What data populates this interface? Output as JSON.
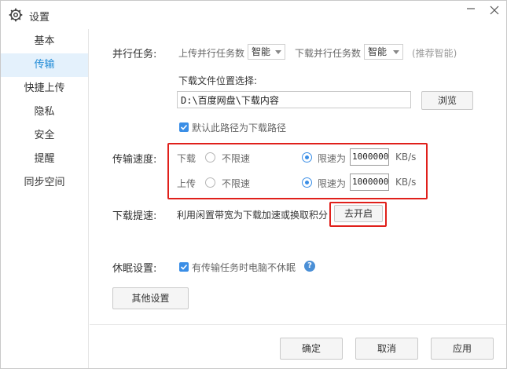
{
  "window": {
    "title": "设置"
  },
  "sidebar": {
    "items": [
      {
        "label": "基本"
      },
      {
        "label": "传输",
        "active": true
      },
      {
        "label": "快捷上传"
      },
      {
        "label": "隐私"
      },
      {
        "label": "安全"
      },
      {
        "label": "提醒"
      },
      {
        "label": "同步空间"
      }
    ]
  },
  "parallel": {
    "label": "并行任务:",
    "upload_label": "上传并行任务数",
    "upload_value": "智能",
    "download_label": "下载并行任务数",
    "download_value": "智能",
    "hint": "(推荐智能)"
  },
  "download_location": {
    "label": "下载文件位置选择:",
    "path": "D:\\百度网盘\\下载内容",
    "browse_label": "浏览",
    "default_checkbox_label": "默认此路径为下载路径",
    "default_checked": true
  },
  "speed": {
    "label": "传输速度:",
    "unlimited_label": "不限速",
    "limit_label": "限速为",
    "unit": "KB/s",
    "download": {
      "label": "下载",
      "value": "1000000",
      "mode": "limit"
    },
    "upload": {
      "label": "上传",
      "value": "1000000",
      "mode": "limit"
    }
  },
  "boost": {
    "label": "下载提速:",
    "description": "利用闲置带宽为下载加速或换取积分",
    "button_label": "去开启"
  },
  "sleep": {
    "label": "休眠设置:",
    "checkbox_label": "有传输任务时电脑不休眠",
    "checked": true,
    "help_glyph": "?"
  },
  "other_settings_label": "其他设置",
  "footer": {
    "ok_label": "确定",
    "cancel_label": "取消",
    "apply_label": "应用"
  },
  "colors": {
    "accent": "#3a8ee6",
    "active_bg": "#e4f1fc",
    "active_text": "#1e8ad6",
    "highlight": "#e0201b"
  }
}
